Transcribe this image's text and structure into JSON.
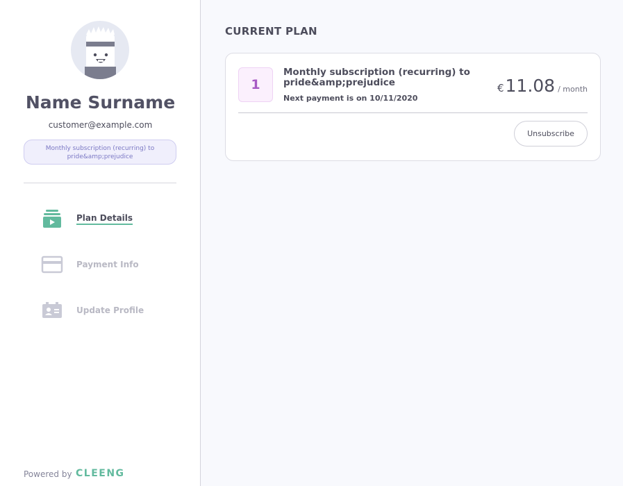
{
  "profile": {
    "name": "Name Surname",
    "email": "customer@example.com",
    "plan_badge": "Monthly subscription (recurring) to pride&amp;prejudice",
    "avatar_icon": "robot-avatar-icon"
  },
  "nav": {
    "items": [
      {
        "label": "Plan Details",
        "icon": "plan-details-icon",
        "active": true
      },
      {
        "label": "Payment Info",
        "icon": "credit-card-icon",
        "active": false
      },
      {
        "label": "Update Profile",
        "icon": "id-card-icon",
        "active": false
      }
    ]
  },
  "footer": {
    "powered_by": "Powered by",
    "brand": "CLEENG"
  },
  "main": {
    "section_title": "CURRENT PLAN",
    "plan": {
      "number": "1",
      "title": "Monthly subscription (recurring) to pride&amp;prejudice",
      "next_payment": "Next payment is on 10/11/2020",
      "currency": "€",
      "amount": "11.08",
      "period": "/ month",
      "unsubscribe_label": "Unsubscribe"
    }
  },
  "colors": {
    "accent_green": "#62ba9e",
    "badge_purple": "#7b78c4",
    "plan_number_purple": "#a75ac4"
  }
}
